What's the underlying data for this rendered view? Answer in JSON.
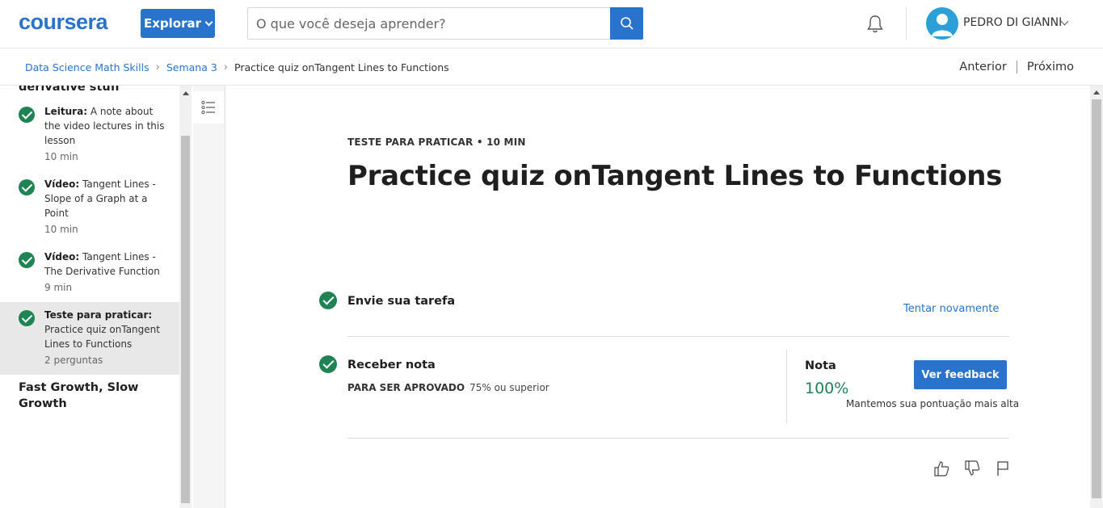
{
  "header": {
    "logo_text": "coursera",
    "explore_label": "Explorar",
    "search_placeholder": "O que você deseja aprender?",
    "user_name": "PEDRO DI GIANNI"
  },
  "breadcrumb": {
    "course": "Data Science Math Skills",
    "week": "Semana 3",
    "current": "Practice quiz onTangent Lines to Functions"
  },
  "pager": {
    "prev": "Anterior",
    "next": "Próximo"
  },
  "sidebar": {
    "section_cut": "derivative stuff",
    "items": [
      {
        "type": "Leitura:",
        "title": "A note about the video lectures in this lesson",
        "meta": "10 min",
        "done": true,
        "active": false
      },
      {
        "type": "Vídeo:",
        "title": "Tangent Lines - Slope of a Graph at a Point",
        "meta": "10 min",
        "done": true,
        "active": false
      },
      {
        "type": "Vídeo:",
        "title": "Tangent Lines - The Derivative Function",
        "meta": "9 min",
        "done": true,
        "active": false
      },
      {
        "type": "Teste para praticar:",
        "title": "Practice quiz onTangent Lines to Functions",
        "meta": "2 perguntas",
        "done": true,
        "active": true
      }
    ],
    "next_section": "Fast Growth, Slow Growth"
  },
  "main": {
    "eyebrow": "TESTE PARA PRATICAR • 10 MIN",
    "title": "Practice quiz onTangent Lines to Functions",
    "step1": {
      "title": "Envie sua tarefa",
      "action": "Tentar novamente"
    },
    "step2": {
      "title": "Receber nota",
      "pass_label": "PARA SER APROVADO",
      "pass_value": "75% ou superior",
      "grade_label": "Nota",
      "grade_value": "100%",
      "feedback_button": "Ver feedback",
      "keep_note": "Mantemos sua pontuação mais alta"
    }
  },
  "colors": {
    "brand": "#2a73cc",
    "success": "#1f8354"
  }
}
